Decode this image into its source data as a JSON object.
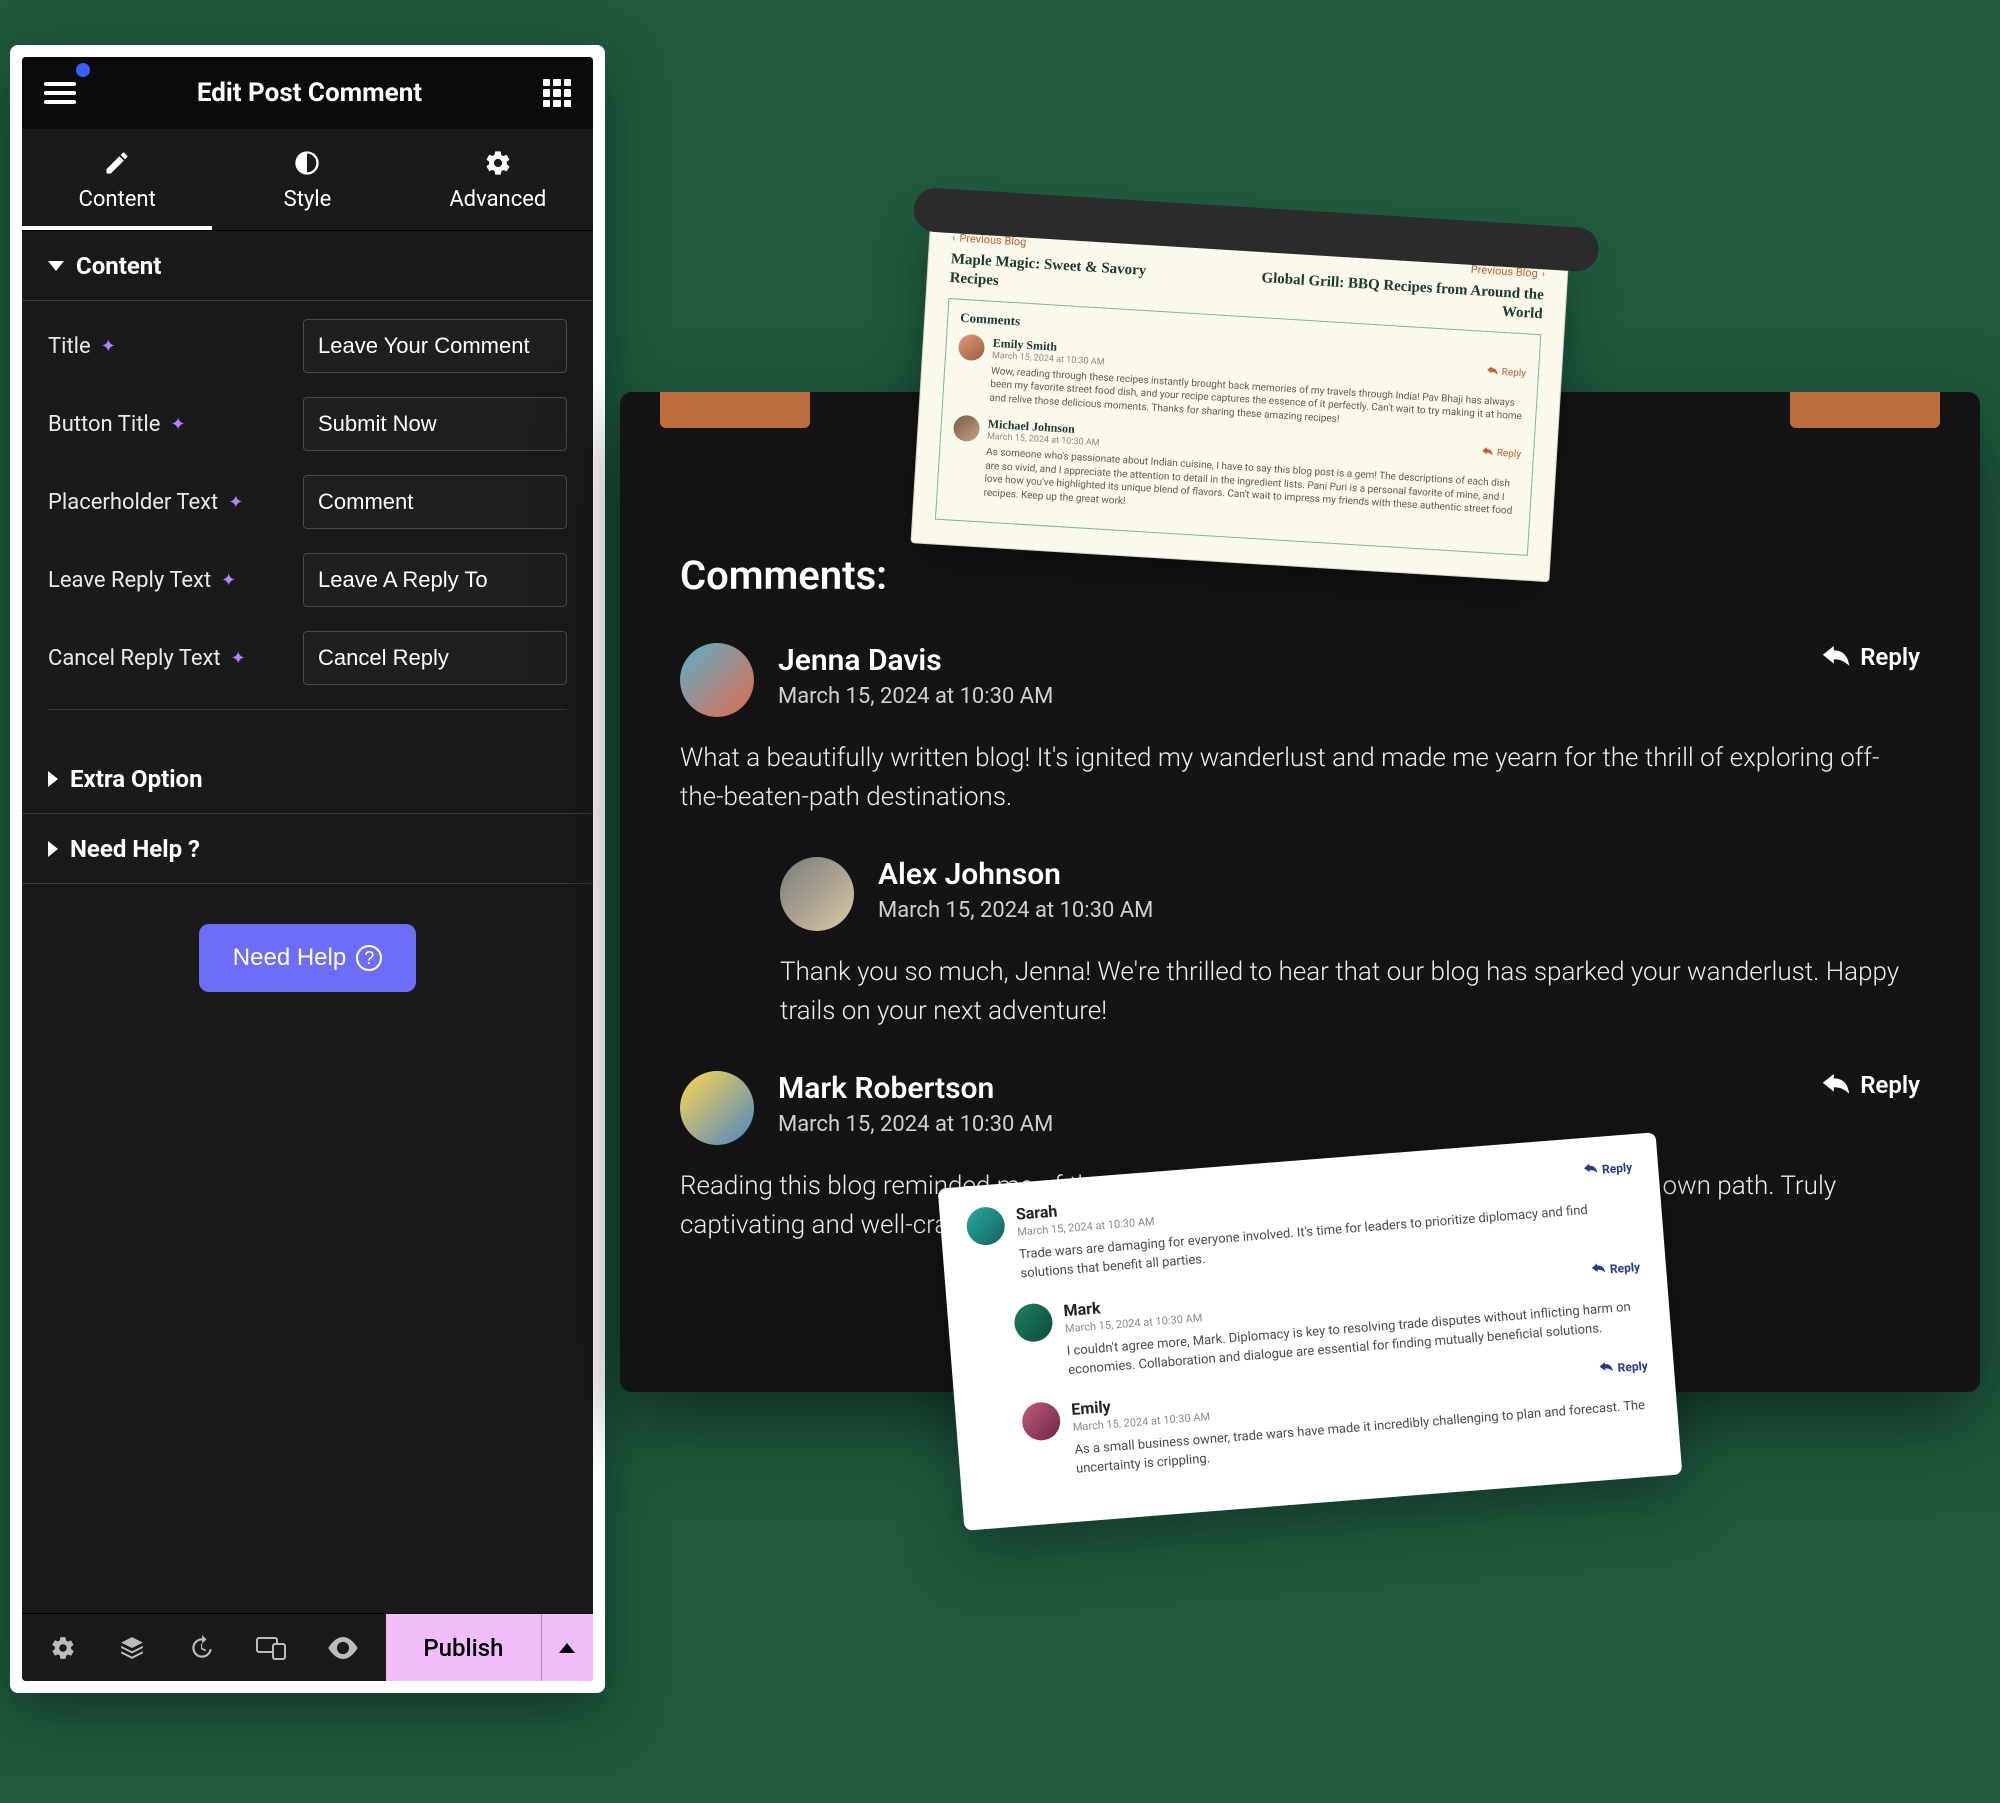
{
  "panel": {
    "title": "Edit Post Comment",
    "tabs": {
      "content": "Content",
      "style": "Style",
      "advanced": "Advanced"
    },
    "section_content": "Content",
    "fields": {
      "title_label": "Title",
      "title_value": "Leave Your Comment",
      "button_title_label": "Button Title",
      "button_title_value": "Submit Now",
      "placeholder_label": "Placerholder Text",
      "placeholder_value": "Comment",
      "leave_reply_label": "Leave Reply Text",
      "leave_reply_value": "Leave A Reply To",
      "cancel_reply_label": "Cancel Reply Text",
      "cancel_reply_value": "Cancel Reply"
    },
    "section_extra": "Extra Option",
    "section_help": "Need Help ?",
    "help_button": "Need Help",
    "publish": "Publish"
  },
  "dark_preview": {
    "heading": "Comments:",
    "reply_label": "Reply",
    "comments": [
      {
        "name": "Jenna Davis",
        "date": "March 15, 2024 at 10:30 AM",
        "body": "What a beautifully written blog! It's ignited my wanderlust and made me yearn for the thrill of exploring off-the-beaten-path destinations.",
        "reply_on_top": true
      },
      {
        "name": "Alex Johnson",
        "date": "March 15, 2024 at 10:30 AM",
        "body": "Thank you so much, Jenna! We're thrilled to hear that our blog has sparked your wanderlust. Happy trails on your next adventure!",
        "nested": true
      },
      {
        "name": "Mark Robertson",
        "date": "March 15, 2024 at 10:30 AM",
        "body": "Reading this blog reminded me of the joy of discovering hidden gems and forging your own path. Truly captivating and well-crafted.",
        "reply_on_top": true
      }
    ]
  },
  "cream_card": {
    "prev_label": "Previous Blog",
    "next_label": "Previous Blog",
    "title_left": "Maple Magic: Sweet & Savory Recipes",
    "title_right": "Global Grill: BBQ Recipes from Around the World",
    "section": "Comments",
    "reply_label": "Reply",
    "comments": [
      {
        "name": "Emily Smith",
        "date": "March 15, 2024 at 10:30 AM",
        "body": "Wow, reading through these recipes instantly brought back memories of my travels through India! Pav Bhaji has always been my favorite street food dish, and your recipe captures the essence of it perfectly. Can't wait to try making it at home and relive those delicious moments. Thanks for sharing these amazing recipes!"
      },
      {
        "name": "Michael Johnson",
        "date": "March 15, 2024 at 10:30 AM",
        "body": "As someone who's passionate about Indian cuisine, I have to say this blog post is a gem! The descriptions of each dish are so vivid, and I appreciate the attention to detail in the ingredient lists. Pani Puri is a personal favorite of mine, and I love how you've highlighted its unique blend of flavors. Can't wait to impress my friends with these authentic street food recipes. Keep up the great work!"
      }
    ]
  },
  "white_card": {
    "reply_label": "Reply",
    "comments": [
      {
        "name": "Sarah",
        "date": "March 15, 2024 at 10:30 AM",
        "body": "Trade wars are damaging for everyone involved. It's time for leaders to prioritize diplomacy and find solutions that benefit all parties."
      },
      {
        "name": "Mark",
        "date": "March 15, 2024 at 10:30 AM",
        "body": "I couldn't agree more, Mark. Diplomacy is key to resolving trade disputes without inflicting harm on economies. Collaboration and dialogue are essential for finding mutually beneficial solutions."
      },
      {
        "name": "Emily",
        "date": "March 15, 2024 at 10:30 AM",
        "body": "As a small business owner, trade wars have made it incredibly challenging to plan and forecast. The uncertainty is crippling."
      }
    ]
  }
}
